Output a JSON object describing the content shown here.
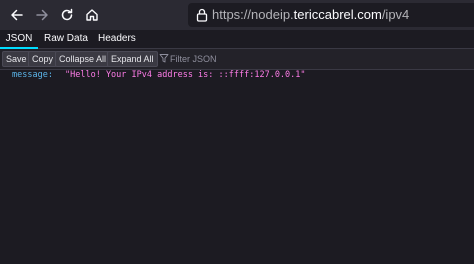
{
  "browser": {
    "url_prefix": "https://nodeip.",
    "url_domain": "tericcabrel.com",
    "url_path": "/ipv4"
  },
  "viewer": {
    "tabs": [
      {
        "label": "JSON",
        "selected": true
      },
      {
        "label": "Raw Data",
        "selected": false
      },
      {
        "label": "Headers",
        "selected": false
      }
    ],
    "toolbar": {
      "save_label": "Save",
      "copy_label": "Copy",
      "collapse_label": "Collapse All",
      "expand_label": "Expand All",
      "filter_placeholder": "Filter JSON"
    },
    "rows": [
      {
        "key": "message:",
        "value": "\"Hello! Your IPv4 address is: ::ffff:127.0.0.1\""
      }
    ]
  },
  "colors": {
    "background": "#1c1b22",
    "key": "#5bb4e8",
    "string_value": "#ff7de9",
    "tab_indicator": "#00ddff"
  },
  "icons": [
    "back-arrow-icon",
    "forward-arrow-icon",
    "reload-icon",
    "home-icon",
    "lock-icon",
    "filter-icon"
  ]
}
